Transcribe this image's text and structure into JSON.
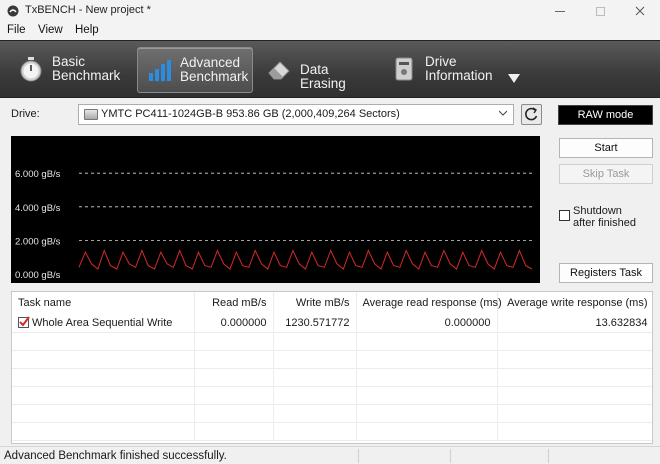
{
  "window": {
    "title": "TxBENCH - New project *"
  },
  "menu": {
    "items": [
      "File",
      "View",
      "Help"
    ]
  },
  "tabs": [
    {
      "label": "Basic\nBenchmark",
      "icon": "stopwatch-icon"
    },
    {
      "label": "Advanced\nBenchmark",
      "icon": "bar-chart-icon",
      "active": true
    },
    {
      "label": "Data Erasing",
      "icon": "eraser-icon"
    },
    {
      "label": "Drive\nInformation",
      "icon": "drive-info-icon"
    }
  ],
  "drive": {
    "label": "Drive:",
    "selected": "YMTC PC411-1024GB-B  953.86 GB (2,000,409,264 Sectors)"
  },
  "buttons": {
    "raw_mode": "RAW mode",
    "start": "Start",
    "skip_task": "Skip Task",
    "shutdown": "Shutdown\nafter finished",
    "registers_task": "Registers Task"
  },
  "chart_data": {
    "type": "line",
    "yticks": [
      "0.000 gB/s",
      "2.000 gB/s",
      "4.000 gB/s",
      "6.000 gB/s"
    ],
    "ylim": [
      0,
      8
    ],
    "grid": true,
    "series": [
      {
        "values": [
          0.4,
          1.3,
          0.6,
          0.3,
          1.4,
          0.5,
          0.3,
          1.3,
          0.6,
          0.4,
          1.4,
          0.5,
          0.3,
          1.3,
          0.6,
          0.4,
          1.4,
          0.5,
          0.3,
          1.3,
          0.5,
          0.4,
          1.4,
          0.6,
          0.3,
          1.3,
          0.5,
          0.4,
          1.4,
          0.6,
          0.3,
          1.3,
          0.5,
          0.4,
          1.4,
          0.6,
          0.3,
          1.3,
          0.5,
          0.4,
          1.4,
          0.6,
          0.3,
          1.3,
          0.5,
          0.4,
          1.4,
          0.6,
          0.3,
          1.3,
          0.5,
          0.4,
          1.4,
          0.6,
          0.3,
          1.3,
          0.5,
          0.4,
          1.4,
          0.6,
          0.3,
          1.3,
          0.5,
          0.4,
          1.4,
          0.6,
          0.3,
          1.3,
          0.5,
          0.4,
          1.4,
          0.5,
          0.3
        ],
        "color": "#d42a2a"
      }
    ]
  },
  "table": {
    "columns": [
      "Task name",
      "Read mB/s",
      "Write mB/s",
      "Average read response (ms)",
      "Average write response (ms)"
    ],
    "rows": [
      [
        "Whole Area Sequential Write",
        "0.000000",
        "1230.571772",
        "0.000000",
        "13.632834"
      ]
    ],
    "empty_rows": 6
  },
  "status": {
    "text": "Advanced Benchmark finished successfully."
  },
  "colors": {
    "accent_line": "#d42a2a",
    "grid": "#d8d8d8"
  }
}
